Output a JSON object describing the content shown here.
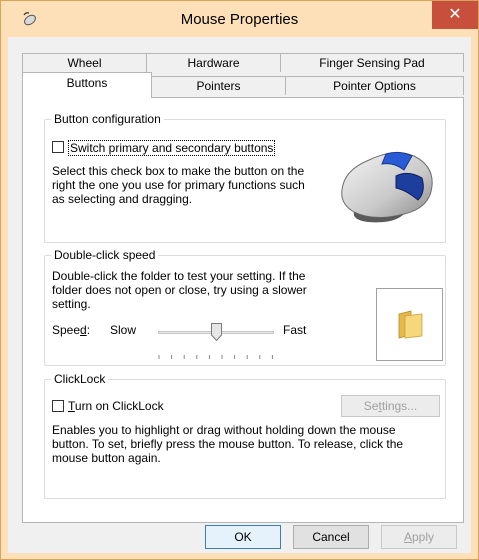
{
  "window": {
    "title": "Mouse Properties",
    "close_glyph": "✕",
    "accent_color": "#fde0b8",
    "close_color": "#c7503c"
  },
  "tabs": {
    "row1": [
      {
        "label": "Wheel"
      },
      {
        "label": "Hardware"
      },
      {
        "label": "Finger Sensing Pad"
      }
    ],
    "row2": [
      {
        "label": "Buttons",
        "active": true
      },
      {
        "label": "Pointers"
      },
      {
        "label": "Pointer Options"
      }
    ]
  },
  "button_config": {
    "title": "Button configuration",
    "checkbox_label": "Switch primary and secondary buttons",
    "checked": false,
    "description_lines": [
      "Select this check box to make the button on the",
      "right the one you use for primary functions such",
      "as selecting and dragging."
    ],
    "image_icon": "mouse-icon"
  },
  "double_click": {
    "title": "Double-click speed",
    "description_lines": [
      "Double-click the folder to test your setting. If the",
      "folder does not open or close, try using a slower",
      "setting."
    ],
    "speed_label_pre": "Spee",
    "speed_label_mnemonic": "d",
    "speed_label_post": ":",
    "slow_label": "Slow",
    "fast_label": "Fast",
    "slider_fraction": 0.5,
    "folder_icon": "folder-icon"
  },
  "clicklock": {
    "title": "ClickLock",
    "checkbox_label_mnemonic": "T",
    "checkbox_label_rest": "urn on ClickLock",
    "checked": false,
    "settings_pre": "Se",
    "settings_mnemonic": "t",
    "settings_post": "tings...",
    "settings_disabled": true,
    "description_lines": [
      "Enables you to highlight or drag without holding down the mouse",
      "button. To set, briefly press the mouse button. To release, click the",
      "mouse button again."
    ]
  },
  "footer": {
    "ok_label": "OK",
    "cancel_label": "Cancel",
    "apply_mnemonic": "A",
    "apply_rest": "pply",
    "apply_disabled": true
  }
}
